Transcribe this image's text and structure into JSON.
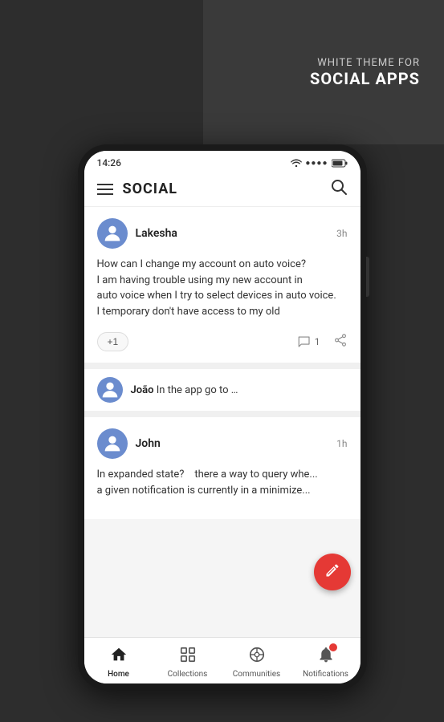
{
  "background": {
    "theme_subtitle": "WHITE THEME FOR",
    "theme_title": "SOCIAL APPS"
  },
  "status_bar": {
    "time": "14:26",
    "wifi": "📶",
    "signal": "●●●●",
    "battery": "🔋"
  },
  "app_bar": {
    "title": "SOCIAL"
  },
  "posts": [
    {
      "id": "post-1",
      "username": "Lakesha",
      "time": "3h",
      "text": "How can I change my account on auto voice?\nI am having trouble using my new account in\nauto voice when I try to select devices in auto voice.\nI temporary don't have access to my old",
      "plus_one": "+1",
      "comment_count": "1"
    },
    {
      "id": "post-2",
      "username": "John",
      "time": "1h",
      "text": "In expanded state?    there a way to query whe...\na given notification is currently in a minimize..."
    }
  ],
  "reply": {
    "username": "João",
    "text": "In the app go to …"
  },
  "fab": {
    "label": "compose",
    "icon": "✏️"
  },
  "bottom_nav": {
    "items": [
      {
        "id": "home",
        "label": "Home",
        "active": true
      },
      {
        "id": "collections",
        "label": "Collections",
        "active": false
      },
      {
        "id": "communities",
        "label": "Communities",
        "active": false
      },
      {
        "id": "notifications",
        "label": "Notifications",
        "active": false,
        "badge": true
      }
    ]
  }
}
